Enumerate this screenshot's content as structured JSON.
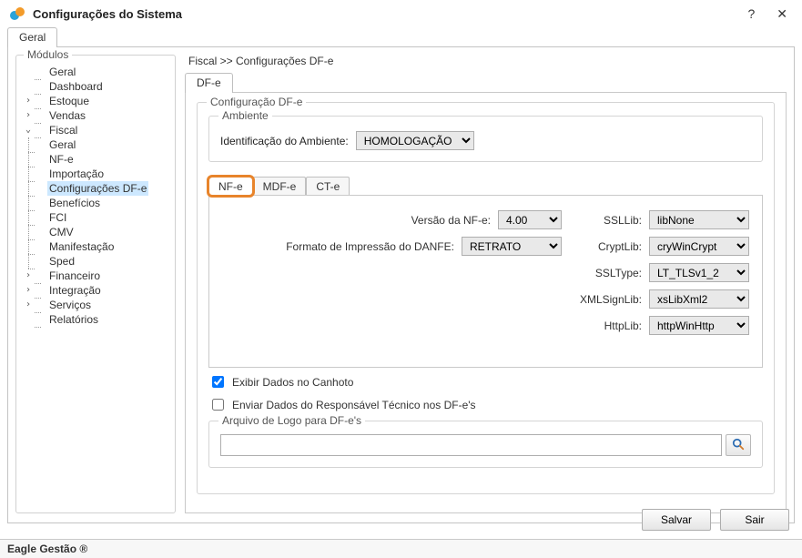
{
  "window": {
    "title": "Configurações do Sistema",
    "help_glyph": "?",
    "close_glyph": "✕"
  },
  "outer_tab": {
    "label": "Geral"
  },
  "modules": {
    "legend": "Módulos",
    "items": [
      {
        "label": "Geral",
        "depth": 1,
        "twisty": ""
      },
      {
        "label": "Dashboard",
        "depth": 1,
        "twisty": ""
      },
      {
        "label": "Estoque",
        "depth": 1,
        "twisty": ">"
      },
      {
        "label": "Vendas",
        "depth": 1,
        "twisty": ">"
      },
      {
        "label": "Fiscal",
        "depth": 1,
        "twisty": "v"
      },
      {
        "label": "Geral",
        "depth": 2,
        "twisty": ""
      },
      {
        "label": "NF-e",
        "depth": 2,
        "twisty": ""
      },
      {
        "label": "Importação",
        "depth": 2,
        "twisty": ""
      },
      {
        "label": "Configurações DF-e",
        "depth": 2,
        "twisty": "",
        "selected": true
      },
      {
        "label": "Benefícios",
        "depth": 2,
        "twisty": ""
      },
      {
        "label": "FCI",
        "depth": 2,
        "twisty": ""
      },
      {
        "label": "CMV",
        "depth": 2,
        "twisty": ""
      },
      {
        "label": "Manifestação",
        "depth": 2,
        "twisty": ""
      },
      {
        "label": "Sped",
        "depth": 2,
        "twisty": ""
      },
      {
        "label": "Financeiro",
        "depth": 1,
        "twisty": ">"
      },
      {
        "label": "Integração",
        "depth": 1,
        "twisty": ">"
      },
      {
        "label": "Serviços",
        "depth": 1,
        "twisty": ">"
      },
      {
        "label": "Relatórios",
        "depth": 1,
        "twisty": ""
      }
    ]
  },
  "breadcrumb": "Fiscal >> Configurações DF-e",
  "subtab": {
    "label": "DF-e"
  },
  "config_group": {
    "legend": "Configuração DF-e",
    "ambiente_legend": "Ambiente",
    "ambiente_label": "Identificação do Ambiente:",
    "ambiente_value": "HOMOLOGAÇÃO",
    "inner_tabs": [
      "NF-e",
      "MDF-e",
      "CT-e"
    ],
    "left_fields": {
      "versao_label": "Versão da NF-e:",
      "versao_value": "4.00",
      "danfe_label": "Formato de Impressão do DANFE:",
      "danfe_value": "RETRATO"
    },
    "right_fields": {
      "ssl_label": "SSLLib:",
      "ssl_value": "libNone",
      "crypt_label": "CryptLib:",
      "crypt_value": "cryWinCrypt",
      "ssltype_label": "SSLType:",
      "ssltype_value": "LT_TLSv1_2",
      "xmlsign_label": "XMLSignLib:",
      "xmlsign_value": "xsLibXml2",
      "http_label": "HttpLib:",
      "http_value": "httpWinHttp"
    },
    "chk_canhoto": "Exibir Dados no Canhoto",
    "chk_canhoto_checked": true,
    "chk_resp": "Enviar Dados do Responsável Técnico nos DF-e's",
    "chk_resp_checked": false,
    "logo_legend": "Arquivo de Logo para DF-e's",
    "logo_value": ""
  },
  "buttons": {
    "save": "Salvar",
    "exit": "Sair"
  },
  "statusbar": "Eagle Gestão ®"
}
